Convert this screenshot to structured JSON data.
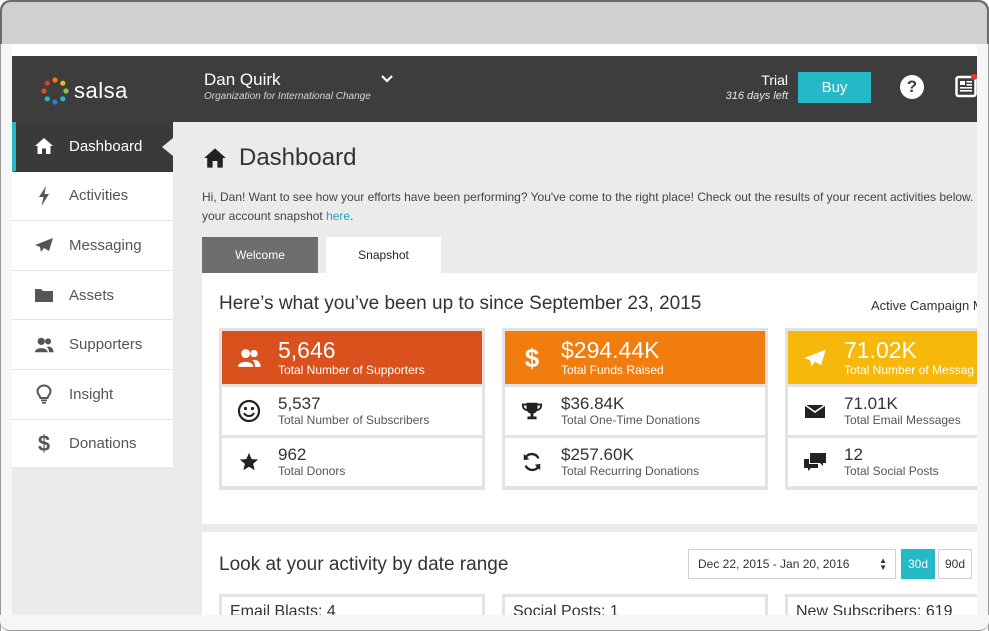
{
  "topbar": {
    "logo_text": "salsa",
    "org_name": "Dan Quirk",
    "org_subtitle": "Organization for International Change",
    "trial_title": "Trial",
    "trial_days": "316 days left",
    "buy_label": "Buy",
    "help_label": "?"
  },
  "sidebar": {
    "items": [
      {
        "label": "Dashboard",
        "icon": "home-icon"
      },
      {
        "label": "Activities",
        "icon": "lightning-icon"
      },
      {
        "label": "Messaging",
        "icon": "paper-plane-icon"
      },
      {
        "label": "Assets",
        "icon": "folder-icon"
      },
      {
        "label": "Supporters",
        "icon": "users-icon"
      },
      {
        "label": "Insight",
        "icon": "lightbulb-icon"
      },
      {
        "label": "Donations",
        "icon": "dollar-icon"
      }
    ]
  },
  "main": {
    "title": "Dashboard",
    "intro_text": "Hi, Dan! Want to see how your efforts have been performing? You've come to the right place! Check out the results of your recent activities below. L",
    "intro_text2": "your account snapshot ",
    "intro_link": "here",
    "intro_end": ".",
    "tabs": [
      {
        "label": "Welcome"
      },
      {
        "label": "Snapshot"
      }
    ]
  },
  "snapshot": {
    "heading": "Here’s what you’ve been up to since September 23, 2015",
    "note": "Active Campaign M",
    "cards": [
      {
        "color": "#d9511c",
        "top_value": "5,646",
        "top_label": "Total Number of Supporters",
        "rows": [
          {
            "value": "5,537",
            "label": "Total Number of Subscribers"
          },
          {
            "value": "962",
            "label": "Total Donors"
          }
        ]
      },
      {
        "color": "#f07d0e",
        "top_value": "$294.44K",
        "top_label": "Total Funds Raised",
        "rows": [
          {
            "value": "$36.84K",
            "label": "Total One-Time Donations"
          },
          {
            "value": "$257.60K",
            "label": "Total Recurring Donations"
          }
        ]
      },
      {
        "color": "#f6b80b",
        "top_value": "71.02K",
        "top_label": "Total Number of Messag",
        "rows": [
          {
            "value": "71.01K",
            "label": "Total Email Messages"
          },
          {
            "value": "12",
            "label": "Total Social Posts"
          }
        ]
      }
    ]
  },
  "activity": {
    "heading": "Look at your activity by date range",
    "date_range": "Dec 22, 2015 - Jan 20, 2016",
    "range_30": "30d",
    "range_90": "90d",
    "boxes": [
      "Email Blasts: 4",
      "Social Posts: 1",
      "New Subscribers: 619"
    ]
  }
}
